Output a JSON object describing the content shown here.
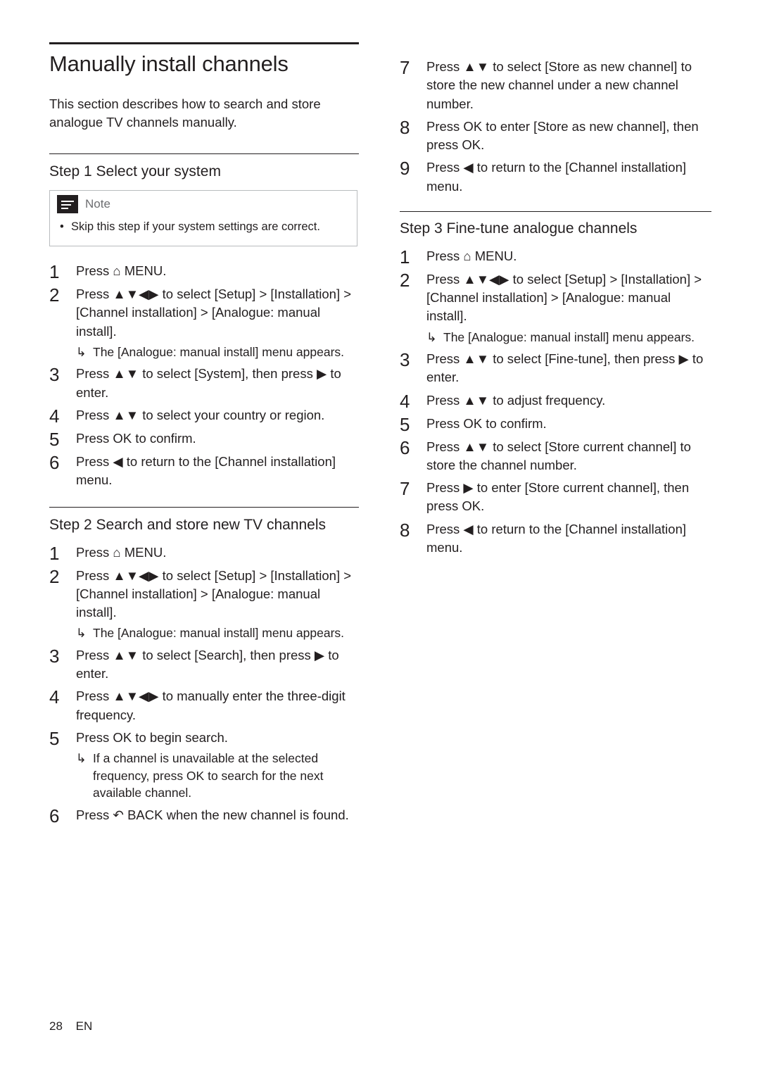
{
  "doc": {
    "title": "Manually install channels",
    "intro": "This section describes how to search and store analogue TV channels manually.",
    "footer": {
      "page": "28",
      "lang": "EN"
    }
  },
  "note": {
    "label": "Note",
    "bullet": "Skip this step if your system settings are correct.",
    "icon": "note-icon"
  },
  "step1": {
    "heading": "Step 1 Select your system",
    "items": [
      {
        "n": "1",
        "text": "Press ⌂ MENU."
      },
      {
        "n": "2",
        "text": "Press ▲▼◀▶ to select [Setup] > [Installation] > [Channel installation] > [Analogue: manual install].",
        "sub": "The [Analogue: manual install] menu appears."
      },
      {
        "n": "3",
        "text": "Press ▲▼ to select [System], then press ▶ to enter."
      },
      {
        "n": "4",
        "text": "Press ▲▼ to select your country or region."
      },
      {
        "n": "5",
        "text": "Press OK to confirm."
      },
      {
        "n": "6",
        "text": "Press ◀ to return to the [Channel installation] menu."
      }
    ]
  },
  "step2": {
    "heading": "Step 2 Search and store new TV channels",
    "items": [
      {
        "n": "1",
        "text": "Press ⌂ MENU."
      },
      {
        "n": "2",
        "text": "Press ▲▼◀▶ to select [Setup] > [Installation] > [Channel installation] > [Analogue: manual install].",
        "sub": "The [Analogue: manual install] menu appears."
      },
      {
        "n": "3",
        "text": "Press ▲▼ to select [Search], then press ▶ to enter."
      },
      {
        "n": "4",
        "text": "Press ▲▼◀▶ to manually enter the three-digit frequency."
      },
      {
        "n": "5",
        "text": "Press OK to begin search.",
        "sub": "If a channel is unavailable at the selected frequency, press OK to search for the next available channel."
      },
      {
        "n": "6",
        "text": "Press ↶ BACK when the new channel is found."
      },
      {
        "n": "7",
        "text": "Press ▲▼ to select [Store as new channel] to store the new channel under a new channel number."
      },
      {
        "n": "8",
        "text": "Press OK to enter [Store as new channel], then press OK."
      },
      {
        "n": "9",
        "text": "Press ◀ to return to the [Channel installation] menu."
      }
    ]
  },
  "step3": {
    "heading": "Step 3 Fine-tune analogue channels",
    "items": [
      {
        "n": "1",
        "text": "Press ⌂ MENU."
      },
      {
        "n": "2",
        "text": "Press ▲▼◀▶ to select [Setup] > [Installation] > [Channel installation] > [Analogue: manual install].",
        "sub": "The [Analogue: manual install] menu appears."
      },
      {
        "n": "3",
        "text": "Press ▲▼ to select [Fine-tune], then press ▶ to enter."
      },
      {
        "n": "4",
        "text": "Press ▲▼ to adjust frequency."
      },
      {
        "n": "5",
        "text": "Press OK to confirm."
      },
      {
        "n": "6",
        "text": "Press ▲▼ to select [Store current channel] to store the channel number."
      },
      {
        "n": "7",
        "text": "Press ▶ to enter [Store current channel], then press OK."
      },
      {
        "n": "8",
        "text": "Press ◀ to return to the [Channel installation] menu."
      }
    ]
  }
}
